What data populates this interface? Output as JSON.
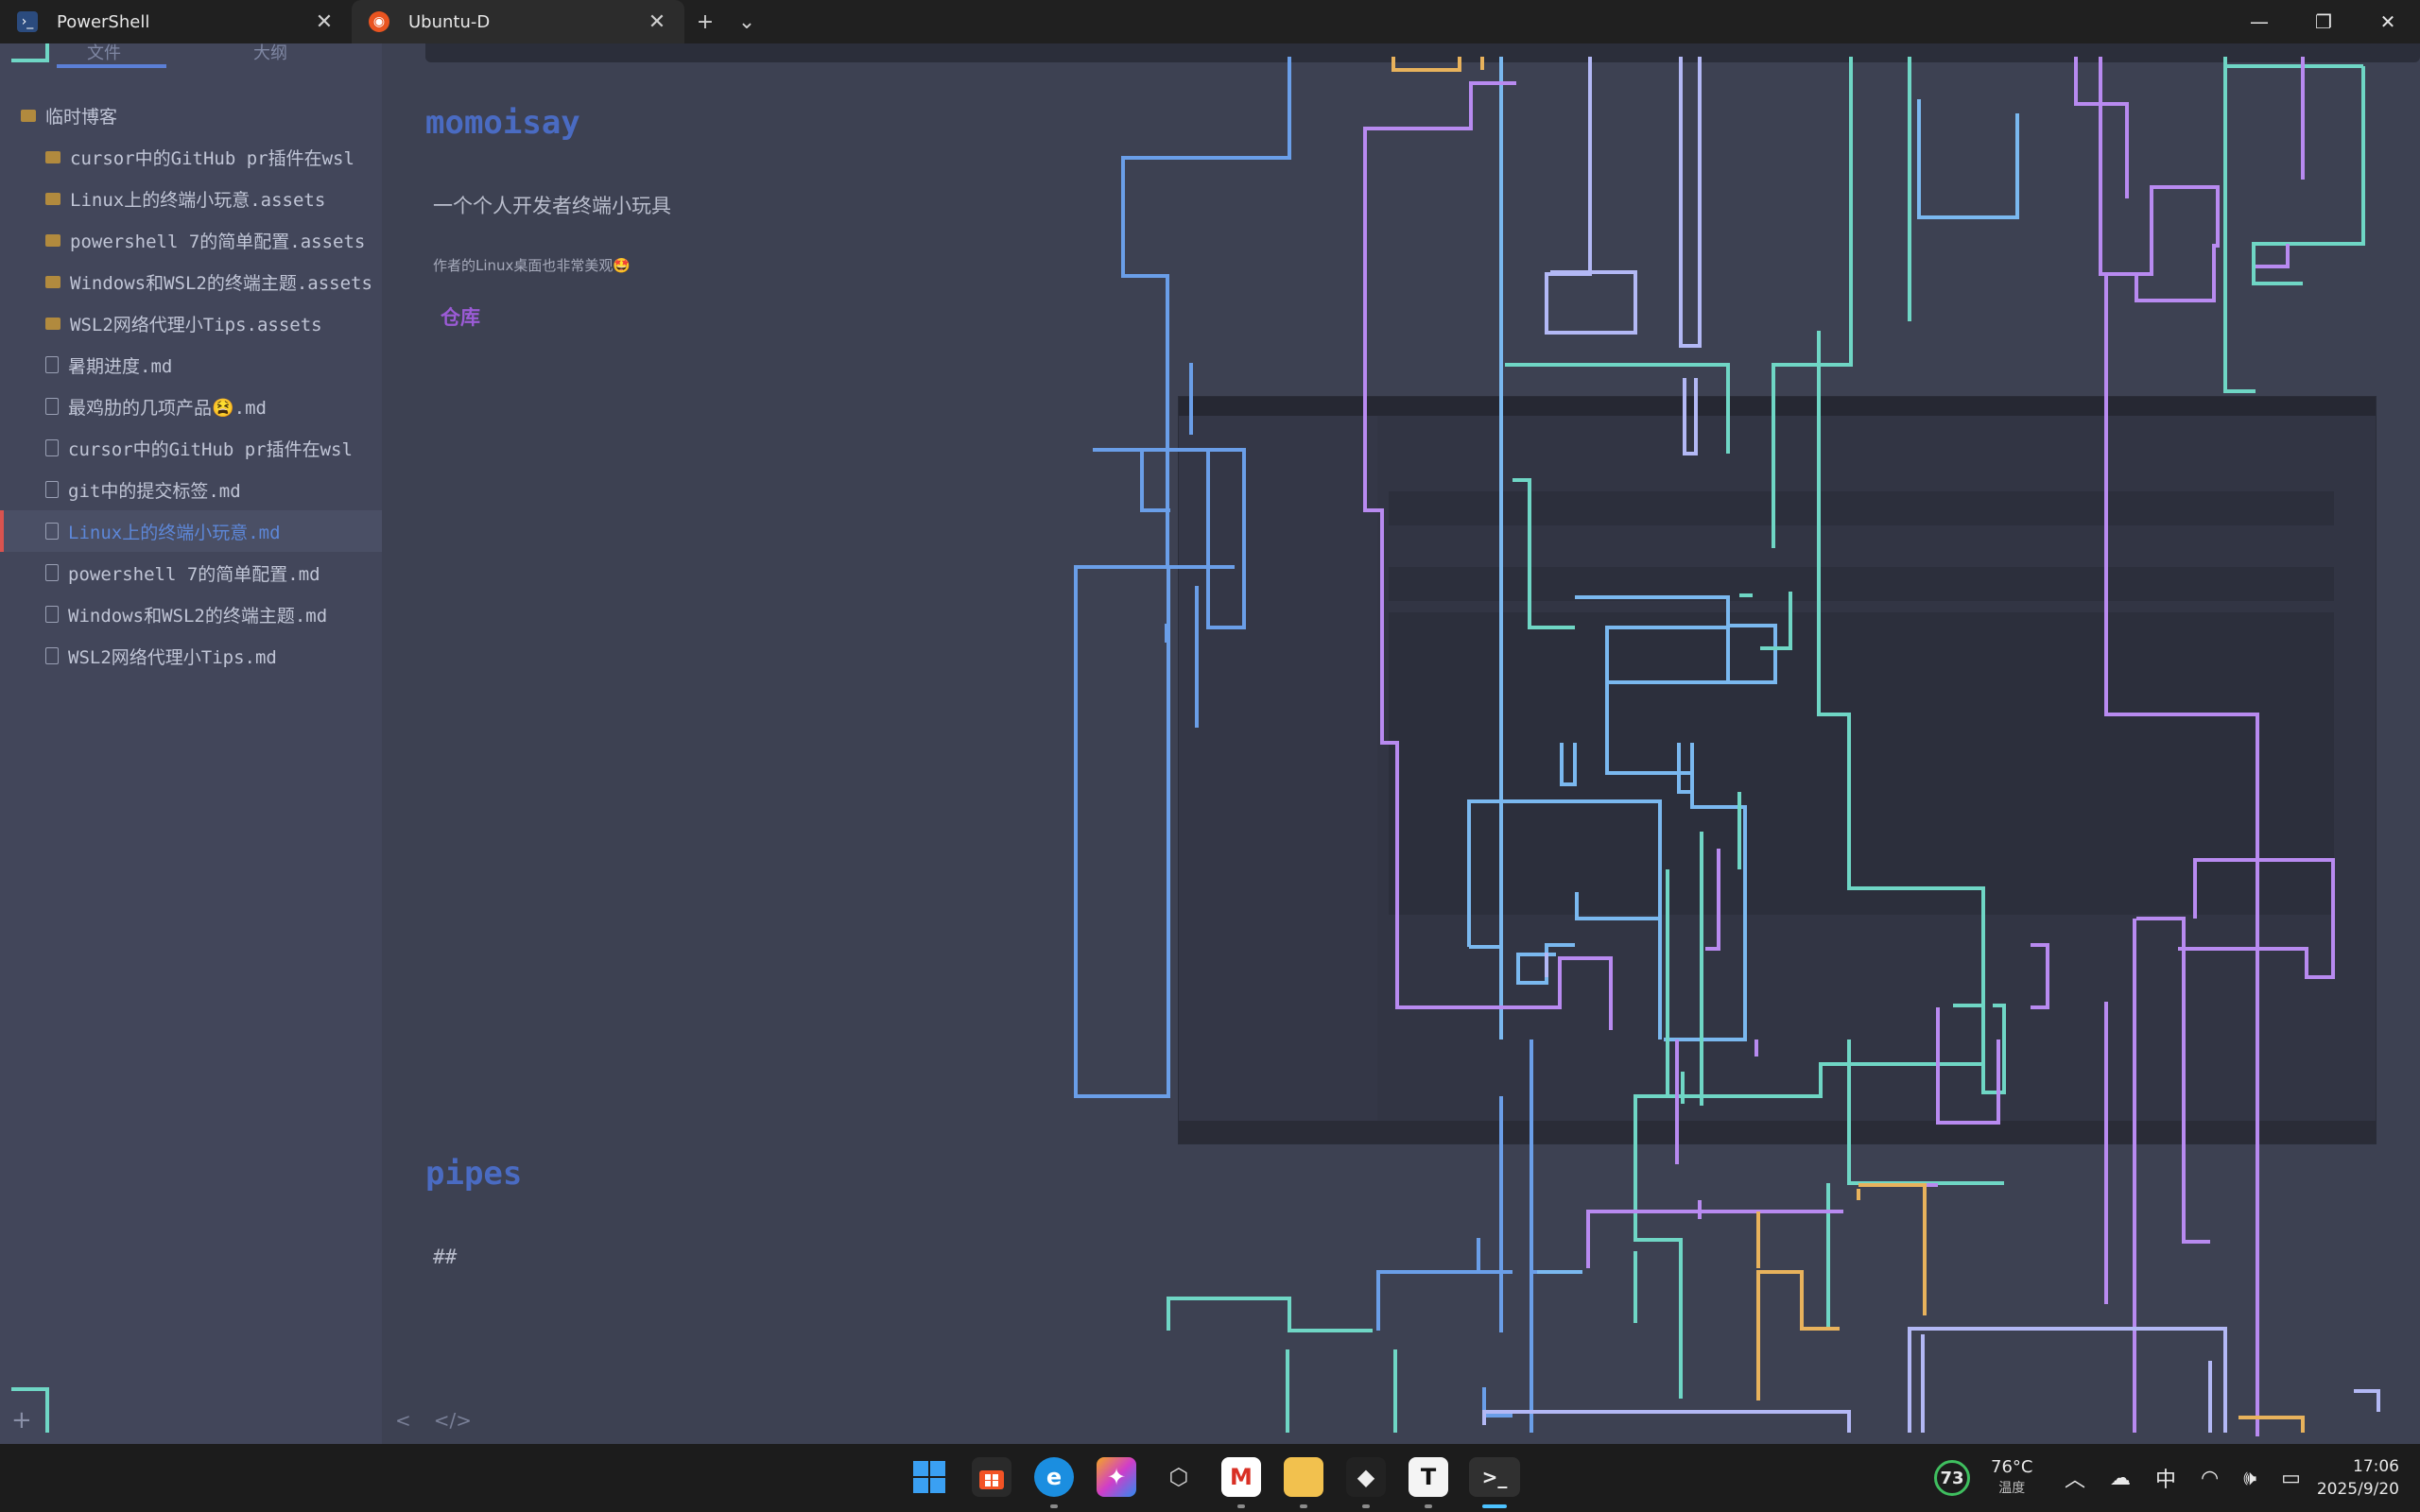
{
  "titlebar": {
    "tabs": [
      {
        "label": "PowerShell",
        "active": false,
        "icon": "powershell-icon"
      },
      {
        "label": "Ubuntu-D",
        "active": true,
        "icon": "ubuntu-icon"
      }
    ],
    "new_tab": "+",
    "dropdown": "⌄",
    "minimize": "—",
    "restore": "❐",
    "close": "✕"
  },
  "sidebar": {
    "tab_files": "文件",
    "tab_outline": "大纲",
    "root": "临时博客",
    "items": [
      {
        "label": "cursor中的GitHub pr插件在wsl",
        "type": "folder"
      },
      {
        "label": "Linux上的终端小玩意.assets",
        "type": "folder"
      },
      {
        "label": "powershell 7的简单配置.assets",
        "type": "folder"
      },
      {
        "label": "Windows和WSL2的终端主题.assets",
        "type": "folder"
      },
      {
        "label": "WSL2网络代理小Tips.assets",
        "type": "folder"
      },
      {
        "label": "暑期进度.md",
        "type": "file"
      },
      {
        "label": "最鸡肋的几项产品😫.md",
        "type": "file"
      },
      {
        "label": "cursor中的GitHub pr插件在wsl",
        "type": "file"
      },
      {
        "label": "git中的提交标签.md",
        "type": "file"
      },
      {
        "label": "Linux上的终端小玩意.md",
        "type": "file",
        "selected": true
      },
      {
        "label": "powershell 7的简单配置.md",
        "type": "file"
      },
      {
        "label": "Windows和WSL2的终端主题.md",
        "type": "file"
      },
      {
        "label": "WSL2网络代理小Tips.md",
        "type": "file"
      }
    ],
    "add": "+"
  },
  "document": {
    "heading1": "momoisay",
    "para1": "一个个人开发者终端小玩具",
    "para2": "作者的Linux桌面也非常美观🤩",
    "link": "仓库",
    "heading2": "pipes",
    "para3": "##",
    "toolbar_back": "<",
    "toolbar_source": "</>"
  },
  "taskbar": {
    "weather_badge": "73",
    "temperature": "76°C",
    "weather_label": "温度",
    "ime": "中",
    "time": "17:06",
    "date": "2025/9/20",
    "apps": [
      "start-icon",
      "store-icon",
      "edge-icon",
      "copilot-icon",
      "unity-icon",
      "gmail-icon",
      "explorer-icon",
      "app-icon",
      "typora-icon",
      "terminal-icon"
    ]
  },
  "colors": {
    "pipe_blue": "#6a9ee8",
    "pipe_lightblue": "#7ab8ef",
    "pipe_green": "#6fd6c5",
    "pipe_purple": "#b88af0",
    "pipe_lavender": "#b3b8f5",
    "pipe_orange": "#e8b25c",
    "accent": "#4a6bc2"
  }
}
